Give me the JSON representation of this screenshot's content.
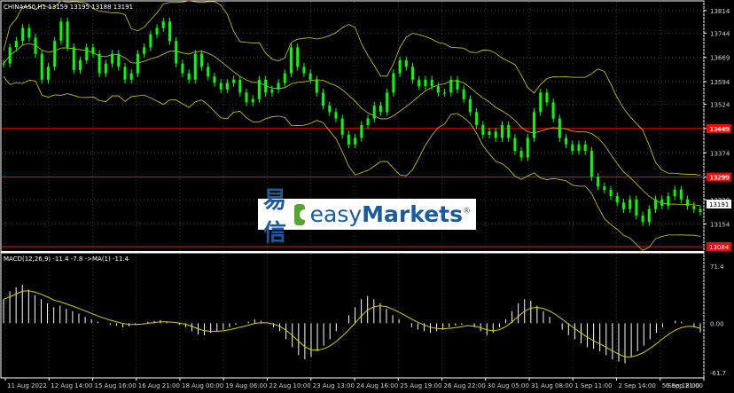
{
  "header": {
    "symbol_line": "CHINAA50,H1  13159 13195 13188 13191"
  },
  "macd": {
    "label": "MACD(12,26,9) -11.4 -7.8  ->MA(1) -11.4"
  },
  "price_axis": {
    "labels": [
      "13814",
      "13744",
      "13669",
      "13594",
      "13524",
      "13449",
      "13374",
      "13299",
      "13229",
      "13154"
    ],
    "current_price": "13191",
    "red_line_labels": [
      "13449",
      "13299",
      "13084"
    ]
  },
  "macd_axis": {
    "labels": [
      "71.4",
      "0.00",
      "-61.7"
    ]
  },
  "time_axis": {
    "labels": [
      "11 Aug 2022",
      "12 Aug 14:00",
      "15 Aug 16:00",
      "16 Aug 21:00",
      "18 Aug 00:00",
      "19 Aug 06:00",
      "22 Aug 10:00",
      "23 Aug 13:00",
      "24 Aug 16:00",
      "25 Aug 19:00",
      "26 Aug 22:00",
      "30 Aug 05:00",
      "31 Aug 08:00",
      "1 Sep 11:00",
      "2 Sep 14:00",
      "5 Sep 18:00",
      "6 Sep 21:00"
    ]
  },
  "logo": {
    "chinese_text": "易信",
    "brand_prefix": "easy",
    "brand_bold": "Markets",
    "registered": "®"
  },
  "colors": {
    "candle": "#00ff00",
    "band": "#d6cf00",
    "hline": "#ff0000",
    "grid": "#3a3a3a",
    "macd_hist": "#ffffff",
    "macd_signal": "#d6cf00"
  },
  "chart_data": {
    "type": "line",
    "instrument": "CHINAA50",
    "timeframe": "H1",
    "price_ylim": [
      13084,
      13830
    ],
    "price_ticks": [
      13814,
      13744,
      13669,
      13594,
      13524,
      13449,
      13374,
      13299,
      13229,
      13154
    ],
    "horizontal_lines": [
      13449,
      13299,
      13084
    ],
    "current_price": 13191,
    "price_series": [
      13650,
      13700,
      13720,
      13760,
      13730,
      13680,
      13600,
      13640,
      13720,
      13780,
      13700,
      13630,
      13660,
      13700,
      13680,
      13620,
      13650,
      13680,
      13640,
      13600,
      13620,
      13680,
      13700,
      13740,
      13760,
      13780,
      13720,
      13650,
      13620,
      13600,
      13680,
      13640,
      13610,
      13590,
      13570,
      13590,
      13600,
      13560,
      13530,
      13540,
      13600,
      13560,
      13570,
      13590,
      13620,
      13700,
      13640,
      13620,
      13600,
      13560,
      13520,
      13500,
      13480,
      13430,
      13400,
      13420,
      13460,
      13480,
      13520,
      13500,
      13560,
      13620,
      13660,
      13640,
      13600,
      13580,
      13600,
      13580,
      13560,
      13560,
      13600,
      13570,
      13540,
      13500,
      13460,
      13430,
      13440,
      13420,
      13460,
      13420,
      13380,
      13360,
      13420,
      13500,
      13560,
      13530,
      13480,
      13420,
      13400,
      13380,
      13400,
      13380,
      13300,
      13270,
      13260,
      13240,
      13220,
      13200,
      13230,
      13180,
      13160,
      13200,
      13230,
      13210,
      13240,
      13260,
      13230,
      13210,
      13200,
      13191
    ],
    "macd_ylim": [
      -61.7,
      71.4
    ],
    "macd_hist": [
      30,
      40,
      45,
      48,
      42,
      35,
      30,
      25,
      20,
      22,
      18,
      15,
      12,
      8,
      5,
      2,
      0,
      -2,
      -3,
      -5,
      -4,
      -2,
      0,
      2,
      3,
      4,
      2,
      0,
      -2,
      -5,
      -10,
      -14,
      -15,
      -12,
      -10,
      -8,
      -5,
      -2,
      0,
      2,
      5,
      3,
      0,
      -5,
      -10,
      -20,
      -30,
      -40,
      -45,
      -42,
      -35,
      -28,
      -20,
      -10,
      0,
      10,
      20,
      30,
      34,
      30,
      25,
      18,
      10,
      5,
      0,
      -5,
      -8,
      -10,
      -12,
      -10,
      -8,
      -5,
      -3,
      -2,
      0,
      -5,
      -10,
      -15,
      -12,
      -5,
      5,
      15,
      25,
      30,
      28,
      22,
      15,
      8,
      0,
      -8,
      -15,
      -20,
      -25,
      -30,
      -32,
      -35,
      -40,
      -45,
      -48,
      -50,
      -42,
      -35,
      -28,
      -20,
      -12,
      -5,
      0,
      3,
      2,
      0,
      -5,
      -11.4
    ],
    "macd_signal_value": -7.8,
    "macd_value": -11.4
  }
}
